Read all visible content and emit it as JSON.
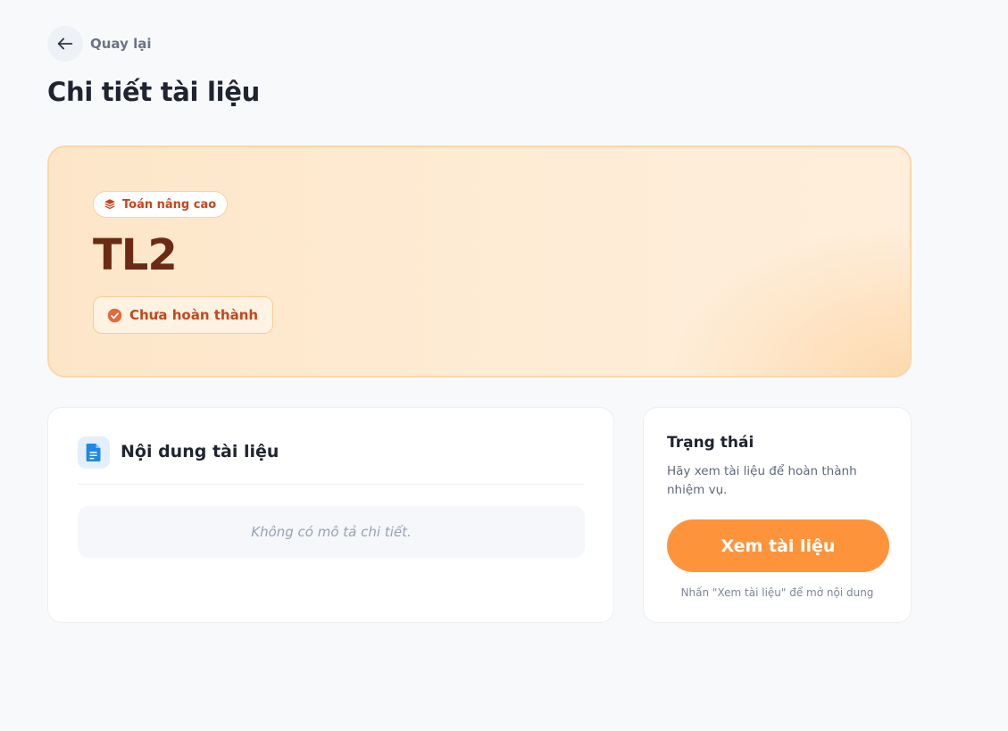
{
  "nav": {
    "back_label": "Quay lại"
  },
  "page": {
    "title": "Chi tiết tài liệu"
  },
  "hero": {
    "category": "Toán nâng cao",
    "document_title": "TL2",
    "status": "Chưa hoàn thành",
    "colors": {
      "accent": "#c4471b",
      "title": "#6b2a13",
      "border": "#fbd7a8"
    }
  },
  "content": {
    "title": "Nội dung tài liệu",
    "empty_text": "Không có mô tả chi tiết."
  },
  "status_panel": {
    "title": "Trạng thái",
    "description": "Hãy xem tài liệu để hoàn thành nhiệm vụ.",
    "button_label": "Xem tài liệu",
    "hint": "Nhấn \"Xem tài liệu\" để mở nội dung",
    "colors": {
      "button": "#fd943c"
    }
  },
  "icons": {
    "back": "arrow-left-icon",
    "category": "layers-icon",
    "status": "check-circle-icon",
    "document": "document-icon"
  }
}
